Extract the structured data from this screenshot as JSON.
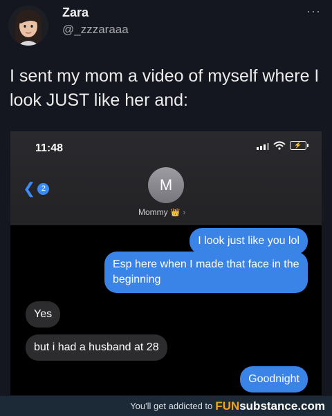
{
  "tweet": {
    "author_name": "Zara",
    "handle": "@_zzzaraaa",
    "more_label": "···",
    "text": "I sent my mom a video of myself where I look JUST like her and:"
  },
  "phone": {
    "time": "11:48",
    "back_badge": "2",
    "contact_initial": "M",
    "contact_name": "Mommy",
    "battery_glyph": "⚡",
    "messages": [
      {
        "side": "out",
        "text": "I look just like you lol"
      },
      {
        "side": "out",
        "text": "Esp here when I made that face in the beginning"
      },
      {
        "side": "in",
        "text": "Yes"
      },
      {
        "side": "in",
        "text": "but i had a husband at 28"
      },
      {
        "side": "out",
        "text": "Goodnight"
      }
    ]
  },
  "footer": {
    "text": "You'll get addicted to",
    "brand_a": "FUN",
    "brand_b": "substance",
    "brand_c": ".com"
  },
  "colors": {
    "background": "#14171f",
    "imessage_blue": "#3a84e8",
    "received_gray": "#2c2c2e",
    "footer_bg": "#1c2a37"
  }
}
